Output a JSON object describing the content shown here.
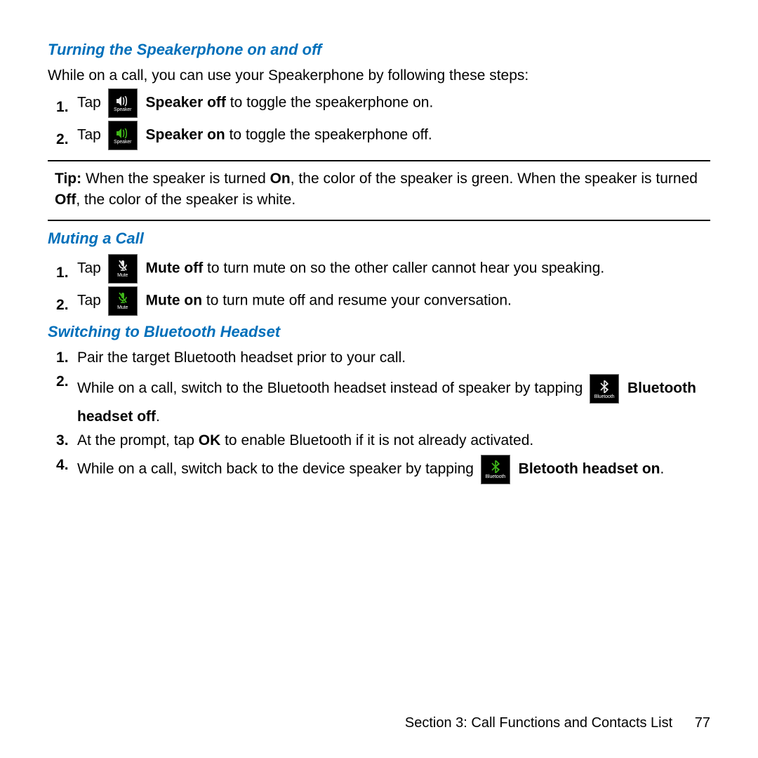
{
  "headings": {
    "speakerphone": "Turning the Speakerphone on and off",
    "mute": "Muting a Call",
    "bt": "Switching to Bluetooth Headset"
  },
  "speaker": {
    "intro": "While on a call, you can use your Speakerphone by following these steps:",
    "s1": {
      "tap": "Tap ",
      "bold": "Speaker off",
      "rest": " to toggle the speakerphone on."
    },
    "s2": {
      "tap": "Tap ",
      "bold": "Speaker on",
      "rest": " to toggle the speakerphone off."
    },
    "btn": "Speaker"
  },
  "tip": {
    "lead": "Tip:",
    "a": " When the speaker is turned ",
    "on": "On",
    "b": ", the color of the speaker is green. When the speaker is turned ",
    "off": "Off",
    "c": ", the color of the speaker is white."
  },
  "mute": {
    "s1": {
      "tap": "Tap ",
      "bold": "Mute off",
      "rest": " to turn mute on so the other caller cannot hear you speaking."
    },
    "s2": {
      "tap": "Tap ",
      "bold": "Mute on",
      "rest": " to turn mute off and resume your conversation."
    },
    "btn": "Mute"
  },
  "bt": {
    "s1": "Pair the target Bluetooth headset prior to your call.",
    "s2": {
      "a": "While on a call, switch to the Bluetooth headset instead of speaker by tapping ",
      "bold": "Bluetooth headset off",
      "end": "."
    },
    "s3": {
      "a": "At the prompt, tap ",
      "ok": "OK",
      "b": " to enable Bluetooth if it is not already activated."
    },
    "s4": {
      "a": "While on a call, switch back to the device speaker by tapping ",
      "bold": "Bletooth headset on",
      "end": "."
    },
    "btn": "Bluetooth"
  },
  "footer": {
    "section": "Section 3:  Call Functions and Contacts List",
    "page": "77"
  }
}
